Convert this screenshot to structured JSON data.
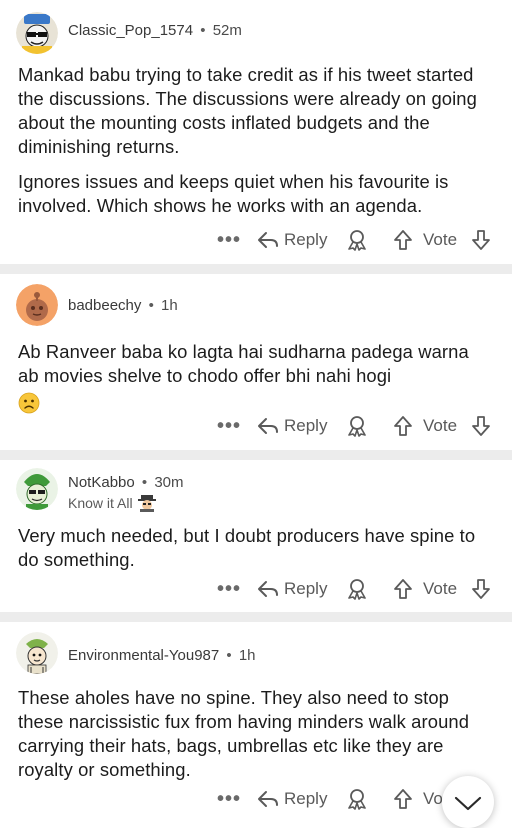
{
  "comments": [
    {
      "username": "Classic_Pop_1574",
      "separator": "•",
      "time": "52m",
      "paragraphs": [
        "Mankad babu trying to take credit as if his tweet started the discussions. The discussions were already on going about the mounting costs inflated budgets and the diminishing returns.",
        "Ignores issues and keeps quiet when his favourite is involved. Which shows he works with an agenda."
      ],
      "actions": {
        "more": "•••",
        "reply": "Reply",
        "vote": "Vote"
      }
    },
    {
      "username": "badbeechy",
      "separator": "•",
      "time": "1h",
      "paragraphs": [
        "Ab Ranveer baba ko lagta hai sudharna padega warna ab movies shelve to chodo offer bhi nahi hogi"
      ],
      "emoji": "frowning-face",
      "actions": {
        "more": "•••",
        "reply": "Reply",
        "vote": "Vote"
      }
    },
    {
      "username": "NotKabbo",
      "separator": "•",
      "time": "30m",
      "flair": "Know it All",
      "flair_icon": "detective-emoji",
      "paragraphs": [
        "Very much needed, but I doubt producers have spine to do something."
      ],
      "actions": {
        "more": "•••",
        "reply": "Reply",
        "vote": "Vote"
      }
    },
    {
      "username": "Environmental-You987",
      "separator": "•",
      "time": "1h",
      "paragraphs": [
        "These aholes have no spine. They also need to stop these narcissistic fux from having minders walk around carrying their hats, bags, umbrellas etc like they are royalty or something."
      ],
      "actions": {
        "more": "•••",
        "reply": "Reply",
        "vote": "Vo"
      }
    }
  ],
  "colors": {
    "text": "#1c1c1c",
    "meta": "#4b4b4b",
    "separator_band": "#ececec",
    "icon": "#5a5a5a"
  }
}
